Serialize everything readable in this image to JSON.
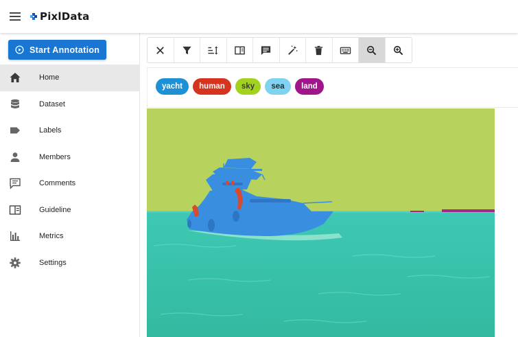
{
  "app": {
    "name": "PixlData"
  },
  "sidebar": {
    "start_button": "Start Annotation",
    "items": [
      {
        "label": "Home",
        "icon": "home-icon",
        "active": true
      },
      {
        "label": "Dataset",
        "icon": "database-icon",
        "active": false
      },
      {
        "label": "Labels",
        "icon": "label-tag-icon",
        "active": false
      },
      {
        "label": "Members",
        "icon": "person-icon",
        "active": false
      },
      {
        "label": "Comments",
        "icon": "comment-icon",
        "active": false
      },
      {
        "label": "Guideline",
        "icon": "book-icon",
        "active": false
      },
      {
        "label": "Metrics",
        "icon": "bar-chart-icon",
        "active": false
      },
      {
        "label": "Settings",
        "icon": "gear-icon",
        "active": false
      }
    ]
  },
  "toolbar": {
    "tools": [
      "close-icon",
      "filter-icon",
      "sort-icon",
      "side-panel-icon",
      "comment-icon",
      "magic-wand-icon",
      "trash-icon",
      "keyboard-icon",
      "zoom-out-icon",
      "zoom-in-icon"
    ],
    "active_tool": "zoom-out-icon"
  },
  "labels": [
    {
      "name": "yacht",
      "color": "#1e90d6"
    },
    {
      "name": "human",
      "color": "#d6341e"
    },
    {
      "name": "sky",
      "color": "#a3d21e"
    },
    {
      "name": "sea",
      "color": "#7fd3f0"
    },
    {
      "name": "land",
      "color": "#a0168a"
    }
  ],
  "colors": {
    "accent": "#1976d2",
    "sky_mask": "#b4d25a",
    "sea_mask": "#2fc7a8",
    "yacht_mask": "#3a8ee0",
    "human_mask": "#d84a2e",
    "land_mask": "#a42a8a"
  }
}
